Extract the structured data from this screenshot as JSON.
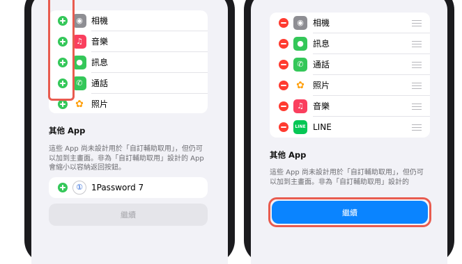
{
  "left_panel": {
    "apps": [
      {
        "name": "相機",
        "icon": "camera-icon",
        "action": "add"
      },
      {
        "name": "音樂",
        "icon": "music-icon",
        "action": "add"
      },
      {
        "name": "訊息",
        "icon": "messages-icon",
        "action": "add"
      },
      {
        "name": "通話",
        "icon": "phone-icon",
        "action": "add"
      },
      {
        "name": "照片",
        "icon": "photos-icon",
        "action": "add"
      }
    ],
    "other_title": "其他 App",
    "other_desc": "這些 App 尚未設計用於「自訂輔助取用」，但仍可以加到主畫面。非為「自訂輔助取用」設計的 App 會縮小以容納返回按鈕。",
    "other_apps": [
      {
        "name": "1Password 7",
        "icon": "1password-icon",
        "action": "add"
      }
    ],
    "continue_label": "繼續",
    "continue_enabled": false
  },
  "right_panel": {
    "apps": [
      {
        "name": "相機",
        "icon": "camera-icon",
        "action": "remove"
      },
      {
        "name": "訊息",
        "icon": "messages-icon",
        "action": "remove"
      },
      {
        "name": "通話",
        "icon": "phone-icon",
        "action": "remove"
      },
      {
        "name": "照片",
        "icon": "photos-icon",
        "action": "remove"
      },
      {
        "name": "音樂",
        "icon": "music-icon",
        "action": "remove"
      },
      {
        "name": "LINE",
        "icon": "line-icon",
        "action": "remove"
      }
    ],
    "other_title": "其他 App",
    "other_desc": "這些 App 尚未設計用於「自訂輔助取用」，但仍可以加到主畫面。非為「自訂輔助取用」設計的",
    "continue_label": "繼續",
    "continue_enabled": true
  },
  "colors": {
    "accent_blue": "#0a84ff",
    "add_green": "#34c759",
    "remove_red": "#ff3b30",
    "highlight_red": "#e85b4f"
  }
}
